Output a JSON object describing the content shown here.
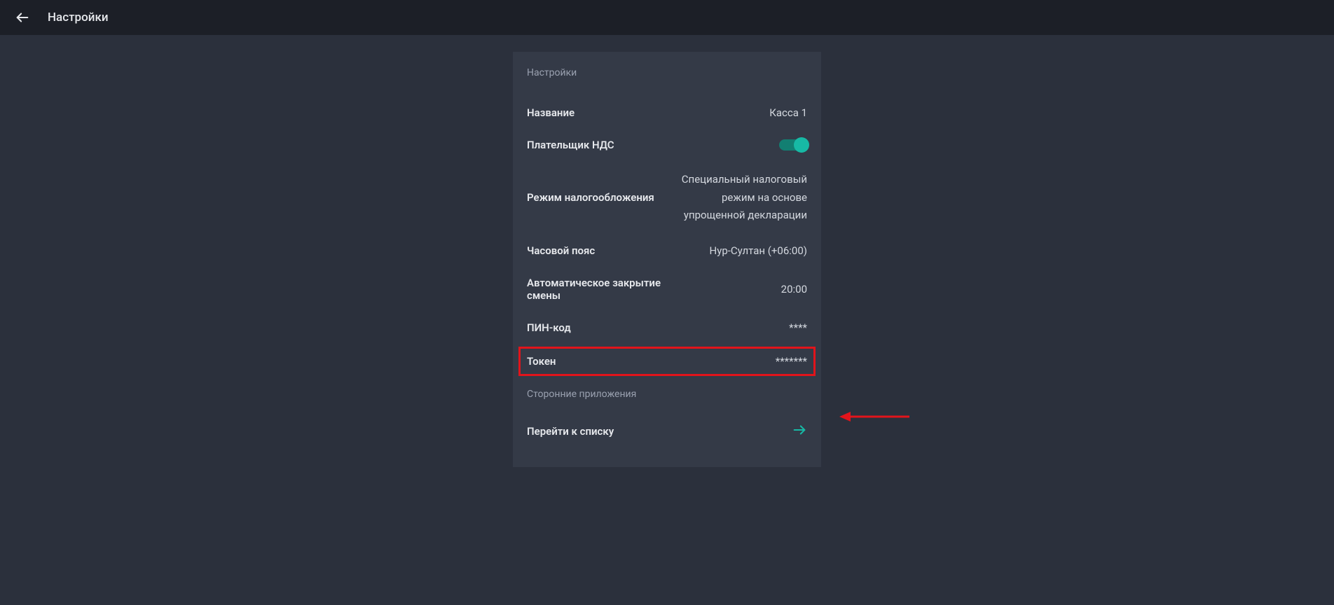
{
  "header": {
    "title": "Настройки"
  },
  "card": {
    "section1_label": "Настройки",
    "rows": {
      "name": {
        "label": "Название",
        "value": "Касса 1"
      },
      "vat": {
        "label": "Плательщик НДС"
      },
      "tax_mode": {
        "label": "Режим налогообложения",
        "value": "Специальный налоговый режим на основе упрощенной декларации"
      },
      "timezone": {
        "label": "Часовой пояс",
        "value": "Нур-Султан (+06:00)"
      },
      "auto_close": {
        "label": "Автоматическое закрытие смены",
        "value": "20:00"
      },
      "pin": {
        "label": "ПИН-код",
        "value": "****"
      },
      "token": {
        "label": "Токен",
        "value": "*******"
      }
    },
    "section2_label": "Сторонние приложения",
    "goto_list": {
      "label": "Перейти к списку"
    }
  }
}
